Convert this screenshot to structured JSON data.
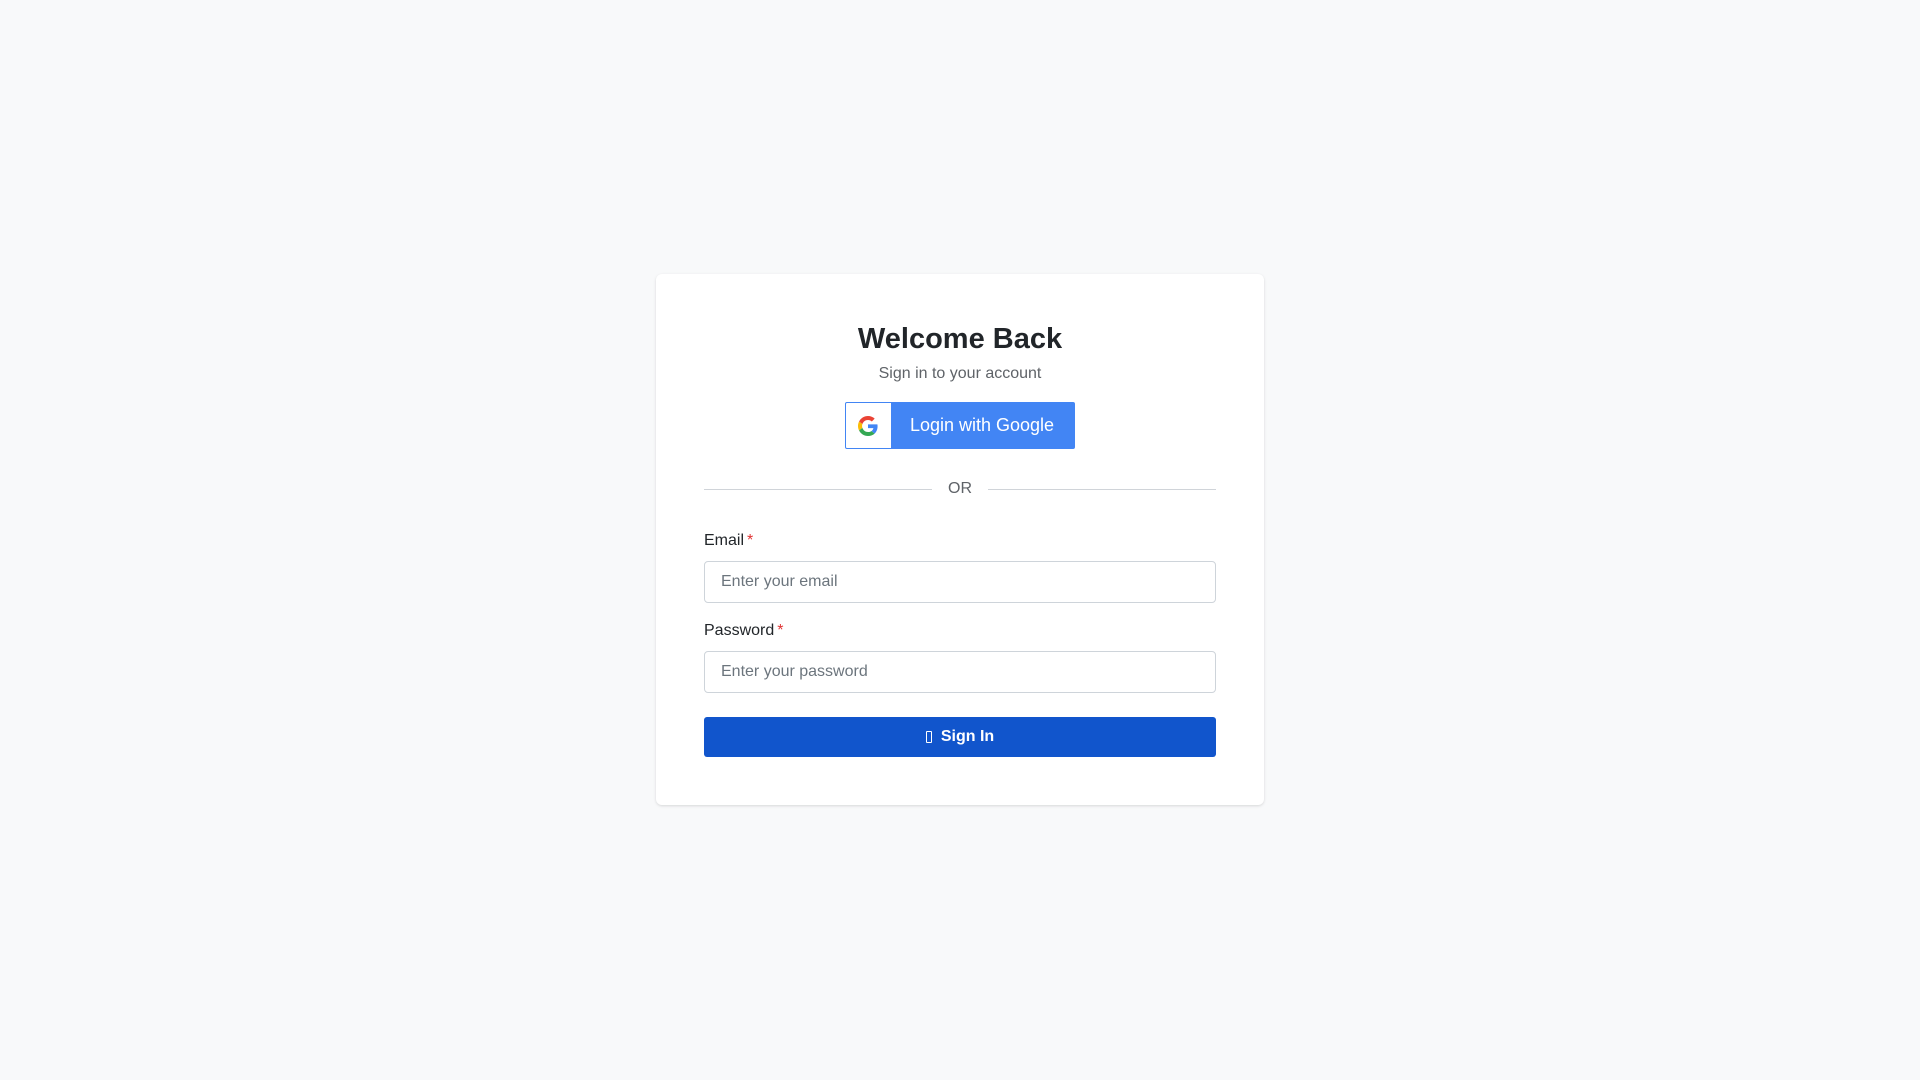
{
  "login": {
    "title": "Welcome Back",
    "subtitle": "Sign in to your account",
    "google_button_label": "Login with Google",
    "google_icon": "google-g-icon",
    "divider_text": "OR",
    "email": {
      "label": "Email",
      "required_mark": "*",
      "value": "",
      "placeholder": "Enter your email"
    },
    "password": {
      "label": "Password",
      "required_mark": "*",
      "value": "",
      "placeholder": "Enter your password"
    },
    "signin_button_label": "Sign In",
    "signin_icon": "sign-in-icon"
  },
  "colors": {
    "page_background": "#f8f9fa",
    "google_blue": "#4285f4",
    "primary_button": "#1155cc",
    "required_red": "#e03131"
  }
}
